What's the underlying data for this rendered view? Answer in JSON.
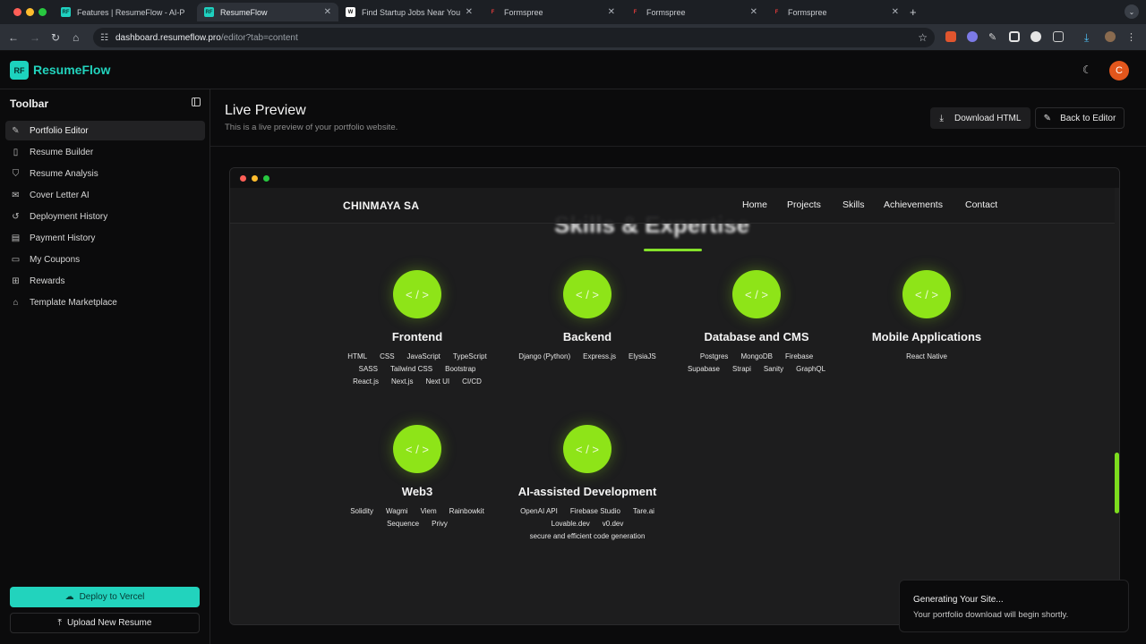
{
  "browser": {
    "tabs": [
      {
        "title": "Features | ResumeFlow - AI-P",
        "active": false
      },
      {
        "title": "ResumeFlow",
        "active": true
      },
      {
        "title": "Find Startup Jobs Near You a",
        "active": false
      },
      {
        "title": "Formspree",
        "active": false
      },
      {
        "title": "Formspree",
        "active": false
      },
      {
        "title": "Formspree",
        "active": false
      }
    ],
    "new_tab": "+",
    "url_host": "dashboard.resumeflow.pro",
    "url_path": "/editor?tab=content"
  },
  "app": {
    "logo_badge": "RF",
    "logo_text": "ResumeFlow",
    "avatar_initial": "C"
  },
  "sidebar": {
    "title": "Toolbar",
    "items": [
      {
        "label": "Portfolio Editor",
        "icon": "✎"
      },
      {
        "label": "Resume Builder",
        "icon": "▯"
      },
      {
        "label": "Resume Analysis",
        "icon": "⛉"
      },
      {
        "label": "Cover Letter AI",
        "icon": "✉"
      },
      {
        "label": "Deployment History",
        "icon": "↺"
      },
      {
        "label": "Payment History",
        "icon": "▤"
      },
      {
        "label": "My Coupons",
        "icon": "▭"
      },
      {
        "label": "Rewards",
        "icon": "⊞"
      },
      {
        "label": "Template Marketplace",
        "icon": "⌂"
      }
    ],
    "deploy_label": "Deploy to Vercel",
    "upload_label": "Upload New Resume"
  },
  "preview": {
    "title": "Live Preview",
    "subtitle": "This is a live preview of your portfolio website.",
    "download_label": "Download HTML",
    "back_label": "Back to Editor"
  },
  "site": {
    "brand": "CHINMAYA SA",
    "nav": [
      "Home",
      "Projects",
      "Skills",
      "Achievements",
      "Contact"
    ],
    "section_title": "Skills & Expertise",
    "icon_glyph": "< / >",
    "skills": [
      {
        "name": "Frontend",
        "tags": [
          "HTML",
          "CSS",
          "JavaScript",
          "TypeScript",
          "SASS",
          "Tailwind CSS",
          "Bootstrap",
          "React.js",
          "Next.js",
          "Next UI",
          "CI/CD"
        ]
      },
      {
        "name": "Backend",
        "tags": [
          "Django (Python)",
          "Express.js",
          "ElysiaJS"
        ]
      },
      {
        "name": "Database and CMS",
        "tags": [
          "Postgres",
          "MongoDB",
          "Firebase",
          "Supabase",
          "Strapi",
          "Sanity",
          "GraphQL"
        ]
      },
      {
        "name": "Mobile Applications",
        "tags": [
          "React Native"
        ]
      },
      {
        "name": "Web3",
        "tags": [
          "Solidity",
          "Wagmi",
          "Viem",
          "Rainbowkit",
          "Sequence",
          "Privy"
        ]
      },
      {
        "name": "AI-assisted Development",
        "tags": [
          "OpenAI API",
          "Firebase Studio",
          "Tare.ai",
          "Lovable.dev",
          "v0.dev",
          "secure and efficient code generation"
        ]
      }
    ]
  },
  "toast": {
    "title": "Generating Your Site...",
    "message": "Your portfolio download will begin shortly."
  },
  "colors": {
    "brand": "#22d3bd",
    "accent_green": "#8ee418",
    "avatar": "#e2561c"
  }
}
